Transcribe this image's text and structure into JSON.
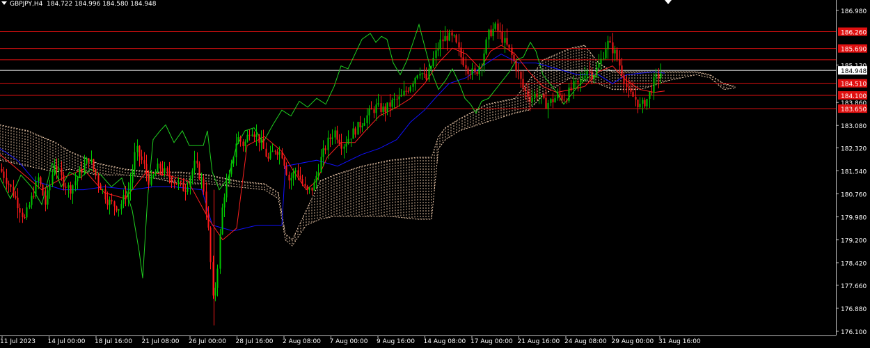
{
  "header": {
    "symbol_timeframe": "GBPJPY,H4",
    "ohlc": "184.722 184.996 184.580 184.948"
  },
  "colors": {
    "background": "#000000",
    "bull_candle": "#00c800",
    "bear_candle": "#ff1a1a",
    "tenkan": "#ff2020",
    "kijun": "#1010ff",
    "chikou": "#20d020",
    "kumo": "#f5d0b0",
    "level_line": "#e01010",
    "current_price_line": "#ffffff",
    "axis_text": "#ffffff",
    "axis_line": "#c0c0c0"
  },
  "chart_data": {
    "type": "candlestick",
    "symbol": "GBPJPY",
    "timeframe": "H4",
    "y_axis_ticks": [
      "186.980",
      "186.260",
      "185.690",
      "185.130",
      "184.948",
      "184.510",
      "184.100",
      "183.860",
      "183.650",
      "183.080",
      "182.320",
      "181.540",
      "180.760",
      "179.980",
      "179.200",
      "178.420",
      "177.660",
      "176.880",
      "176.100"
    ],
    "ylim": [
      176.1,
      187.3
    ],
    "x_axis_ticks": [
      "11 Jul 2023",
      "14 Jul 00:00",
      "18 Jul 16:00",
      "21 Jul 08:00",
      "26 Jul 00:00",
      "28 Jul 16:00",
      "2 Aug 08:00",
      "7 Aug 00:00",
      "9 Aug 16:00",
      "14 Aug 08:00",
      "17 Aug 00:00",
      "21 Aug 16:00",
      "24 Aug 08:00",
      "29 Aug 00:00",
      "31 Aug 16:00"
    ],
    "levels": [
      {
        "label": "186.260",
        "value": 186.26
      },
      {
        "label": "185.690",
        "value": 185.69
      },
      {
        "label": "185.307",
        "value": 185.307
      },
      {
        "label": "184.510",
        "value": 184.51
      },
      {
        "label": "184.100",
        "value": 184.1
      },
      {
        "label": "183.650",
        "value": 183.65
      }
    ],
    "current_price": {
      "label": "184.948",
      "value": 184.948
    },
    "price_path": [
      [
        0,
        181.6
      ],
      [
        10,
        181.2
      ],
      [
        22,
        180.6
      ],
      [
        35,
        179.9
      ],
      [
        45,
        180.6
      ],
      [
        55,
        181.3
      ],
      [
        65,
        180.4
      ],
      [
        78,
        181.8
      ],
      [
        90,
        181.2
      ],
      [
        100,
        180.9
      ],
      [
        115,
        181.5
      ],
      [
        128,
        182.0
      ],
      [
        140,
        181.2
      ],
      [
        155,
        180.5
      ],
      [
        170,
        180.3
      ],
      [
        185,
        180.9
      ],
      [
        195,
        182.3
      ],
      [
        205,
        181.8
      ],
      [
        215,
        181.1
      ],
      [
        228,
        181.7
      ],
      [
        240,
        181.4
      ],
      [
        255,
        181.1
      ],
      [
        265,
        180.9
      ],
      [
        280,
        181.8
      ],
      [
        292,
        181.0
      ],
      [
        300,
        179.3
      ],
      [
        306,
        177.0
      ],
      [
        312,
        178.3
      ],
      [
        320,
        180.6
      ],
      [
        330,
        181.4
      ],
      [
        340,
        182.7
      ],
      [
        350,
        182.4
      ],
      [
        360,
        183.0
      ],
      [
        372,
        182.6
      ],
      [
        385,
        181.9
      ],
      [
        395,
        182.3
      ],
      [
        405,
        182.1
      ],
      [
        415,
        181.2
      ],
      [
        425,
        181.6
      ],
      [
        440,
        180.8
      ],
      [
        450,
        181.0
      ],
      [
        460,
        181.9
      ],
      [
        470,
        182.5
      ],
      [
        480,
        182.9
      ],
      [
        492,
        182.4
      ],
      [
        505,
        182.8
      ],
      [
        520,
        183.2
      ],
      [
        530,
        183.5
      ],
      [
        540,
        183.7
      ],
      [
        552,
        183.6
      ],
      [
        565,
        183.9
      ],
      [
        575,
        184.0
      ],
      [
        590,
        184.5
      ],
      [
        602,
        185.0
      ],
      [
        612,
        184.6
      ],
      [
        622,
        185.3
      ],
      [
        632,
        185.9
      ],
      [
        642,
        186.1
      ],
      [
        652,
        186.0
      ],
      [
        662,
        185.4
      ],
      [
        672,
        185.0
      ],
      [
        682,
        184.8
      ],
      [
        692,
        185.3
      ],
      [
        702,
        186.2
      ],
      [
        712,
        186.4
      ],
      [
        722,
        186.0
      ],
      [
        732,
        185.6
      ],
      [
        742,
        185.0
      ],
      [
        752,
        184.3
      ],
      [
        762,
        184.0
      ],
      [
        772,
        184.2
      ],
      [
        782,
        183.8
      ],
      [
        792,
        183.9
      ],
      [
        802,
        184.1
      ],
      [
        812,
        184.0
      ],
      [
        822,
        184.4
      ],
      [
        832,
        184.5
      ],
      [
        842,
        185.0
      ],
      [
        852,
        184.8
      ],
      [
        862,
        185.2
      ],
      [
        872,
        185.9
      ],
      [
        882,
        185.6
      ],
      [
        892,
        185.0
      ],
      [
        902,
        184.2
      ],
      [
        912,
        184.0
      ],
      [
        920,
        183.7
      ],
      [
        930,
        184.0
      ],
      [
        940,
        184.6
      ],
      [
        950,
        184.9
      ]
    ],
    "tenkan_path": [
      [
        0,
        182.1
      ],
      [
        30,
        181.5
      ],
      [
        60,
        180.9
      ],
      [
        90,
        181.3
      ],
      [
        120,
        181.6
      ],
      [
        150,
        180.8
      ],
      [
        180,
        180.6
      ],
      [
        210,
        181.5
      ],
      [
        240,
        181.4
      ],
      [
        270,
        181.2
      ],
      [
        300,
        179.9
      ],
      [
        320,
        179.2
      ],
      [
        340,
        179.6
      ],
      [
        355,
        182.4
      ],
      [
        380,
        182.7
      ],
      [
        405,
        182.2
      ],
      [
        420,
        181.6
      ],
      [
        440,
        180.9
      ],
      [
        455,
        181.2
      ],
      [
        470,
        182.0
      ],
      [
        490,
        182.5
      ],
      [
        510,
        182.5
      ],
      [
        525,
        182.9
      ],
      [
        545,
        183.4
      ],
      [
        570,
        183.7
      ],
      [
        590,
        184.0
      ],
      [
        610,
        184.5
      ],
      [
        630,
        185.2
      ],
      [
        650,
        185.7
      ],
      [
        670,
        185.5
      ],
      [
        690,
        185.0
      ],
      [
        705,
        185.6
      ],
      [
        720,
        185.8
      ],
      [
        740,
        185.5
      ],
      [
        760,
        184.9
      ],
      [
        780,
        184.4
      ],
      [
        800,
        184.2
      ],
      [
        820,
        184.3
      ],
      [
        840,
        184.4
      ],
      [
        860,
        184.9
      ],
      [
        880,
        185.1
      ],
      [
        900,
        184.6
      ],
      [
        920,
        184.3
      ],
      [
        940,
        184.2
      ],
      [
        955,
        184.25
      ]
    ],
    "kijun_path": [
      [
        0,
        182.3
      ],
      [
        25,
        181.9
      ],
      [
        50,
        181.2
      ],
      [
        90,
        180.9
      ],
      [
        120,
        180.9
      ],
      [
        150,
        181.0
      ],
      [
        190,
        180.9
      ],
      [
        220,
        181.0
      ],
      [
        250,
        181.0
      ],
      [
        290,
        180.9
      ],
      [
        305,
        179.7
      ],
      [
        335,
        179.5
      ],
      [
        370,
        179.7
      ],
      [
        405,
        179.7
      ],
      [
        410,
        181.7
      ],
      [
        455,
        181.9
      ],
      [
        485,
        181.7
      ],
      [
        520,
        182.1
      ],
      [
        545,
        182.3
      ],
      [
        570,
        182.6
      ],
      [
        590,
        183.2
      ],
      [
        610,
        183.6
      ],
      [
        625,
        184.0
      ],
      [
        645,
        184.5
      ],
      [
        670,
        184.7
      ],
      [
        700,
        185.2
      ],
      [
        720,
        185.5
      ],
      [
        745,
        185.2
      ],
      [
        770,
        185.2
      ],
      [
        800,
        185.0
      ],
      [
        830,
        184.8
      ],
      [
        860,
        184.8
      ],
      [
        880,
        184.5
      ],
      [
        900,
        184.8
      ],
      [
        940,
        184.9
      ],
      [
        955,
        184.85
      ]
    ],
    "chikou_path": [
      [
        0,
        181.3
      ],
      [
        15,
        180.6
      ],
      [
        30,
        181.4
      ],
      [
        45,
        181.0
      ],
      [
        60,
        180.4
      ],
      [
        75,
        181.8
      ],
      [
        88,
        181.0
      ],
      [
        100,
        181.5
      ],
      [
        115,
        181.3
      ],
      [
        130,
        181.6
      ],
      [
        145,
        181.4
      ],
      [
        160,
        181.0
      ],
      [
        175,
        181.3
      ],
      [
        190,
        180.2
      ],
      [
        200,
        178.8
      ],
      [
        205,
        177.9
      ],
      [
        212,
        180.6
      ],
      [
        220,
        182.6
      ],
      [
        230,
        182.9
      ],
      [
        238,
        183.1
      ],
      [
        250,
        182.5
      ],
      [
        262,
        182.9
      ],
      [
        272,
        182.4
      ],
      [
        280,
        182.4
      ],
      [
        292,
        182.4
      ],
      [
        298,
        182.9
      ],
      [
        305,
        181.5
      ],
      [
        315,
        180.9
      ],
      [
        328,
        181.3
      ],
      [
        340,
        182.4
      ],
      [
        352,
        182.9
      ],
      [
        365,
        183.0
      ],
      [
        378,
        182.5
      ],
      [
        392,
        183.1
      ],
      [
        405,
        183.6
      ],
      [
        418,
        183.4
      ],
      [
        430,
        183.9
      ],
      [
        442,
        183.7
      ],
      [
        455,
        184.0
      ],
      [
        468,
        183.8
      ],
      [
        480,
        184.4
      ],
      [
        490,
        185.1
      ],
      [
        500,
        185.0
      ],
      [
        510,
        185.5
      ],
      [
        520,
        186.0
      ],
      [
        532,
        186.2
      ],
      [
        540,
        185.9
      ],
      [
        548,
        186.1
      ],
      [
        556,
        186.0
      ],
      [
        565,
        185.2
      ],
      [
        575,
        184.8
      ],
      [
        585,
        185.3
      ],
      [
        595,
        186.0
      ],
      [
        602,
        186.5
      ],
      [
        612,
        185.6
      ],
      [
        620,
        184.9
      ],
      [
        630,
        184.3
      ],
      [
        640,
        184.6
      ],
      [
        650,
        185.0
      ],
      [
        660,
        184.5
      ],
      [
        668,
        184.0
      ],
      [
        676,
        183.8
      ],
      [
        684,
        183.5
      ],
      [
        692,
        183.9
      ],
      [
        702,
        184.0
      ],
      [
        712,
        184.3
      ],
      [
        722,
        184.6
      ],
      [
        732,
        184.9
      ],
      [
        742,
        185.3
      ],
      [
        752,
        185.4
      ],
      [
        762,
        185.9
      ],
      [
        770,
        185.6
      ],
      [
        780,
        184.8
      ],
      [
        790,
        184.5
      ],
      [
        800,
        184.2
      ],
      [
        810,
        183.8
      ],
      [
        820,
        184.1
      ],
      [
        830,
        184.4
      ],
      [
        840,
        184.6
      ],
      [
        850,
        184.8
      ],
      [
        860,
        184.7
      ]
    ],
    "cloud_upper": [
      [
        0,
        183.1
      ],
      [
        40,
        182.9
      ],
      [
        80,
        182.5
      ],
      [
        100,
        182.2
      ],
      [
        140,
        181.8
      ],
      [
        180,
        181.6
      ],
      [
        220,
        181.5
      ],
      [
        260,
        181.5
      ],
      [
        300,
        181.4
      ],
      [
        340,
        181.2
      ],
      [
        380,
        181.1
      ],
      [
        400,
        180.8
      ],
      [
        410,
        179.4
      ],
      [
        420,
        179.2
      ],
      [
        440,
        180.2
      ],
      [
        460,
        181.2
      ],
      [
        480,
        181.4
      ],
      [
        520,
        181.7
      ],
      [
        560,
        181.9
      ],
      [
        600,
        182.0
      ],
      [
        620,
        182.0
      ],
      [
        630,
        182.7
      ],
      [
        640,
        183.0
      ],
      [
        660,
        183.3
      ],
      [
        700,
        183.8
      ],
      [
        740,
        184.0
      ],
      [
        760,
        184.6
      ],
      [
        780,
        185.3
      ],
      [
        800,
        185.5
      ],
      [
        820,
        185.7
      ],
      [
        840,
        185.8
      ],
      [
        860,
        185.2
      ],
      [
        880,
        184.9
      ],
      [
        920,
        184.9
      ],
      [
        960,
        184.9
      ],
      [
        1000,
        184.9
      ],
      [
        1020,
        184.8
      ],
      [
        1040,
        184.5
      ],
      [
        1056,
        184.4
      ]
    ],
    "cloud_lower": [
      [
        0,
        181.9
      ],
      [
        40,
        181.7
      ],
      [
        80,
        181.5
      ],
      [
        100,
        181.6
      ],
      [
        140,
        181.4
      ],
      [
        180,
        181.4
      ],
      [
        220,
        181.3
      ],
      [
        260,
        181.1
      ],
      [
        300,
        181.1
      ],
      [
        340,
        181.0
      ],
      [
        380,
        180.9
      ],
      [
        400,
        180.6
      ],
      [
        410,
        179.2
      ],
      [
        420,
        179.0
      ],
      [
        440,
        179.7
      ],
      [
        460,
        179.9
      ],
      [
        480,
        180.0
      ],
      [
        520,
        180.0
      ],
      [
        560,
        180.0
      ],
      [
        600,
        179.9
      ],
      [
        620,
        179.9
      ],
      [
        630,
        182.3
      ],
      [
        640,
        182.6
      ],
      [
        660,
        182.9
      ],
      [
        700,
        183.2
      ],
      [
        740,
        183.5
      ],
      [
        760,
        183.6
      ],
      [
        780,
        184.1
      ],
      [
        800,
        184.4
      ],
      [
        820,
        184.7
      ],
      [
        840,
        184.6
      ],
      [
        860,
        184.5
      ],
      [
        880,
        184.3
      ],
      [
        920,
        184.3
      ],
      [
        960,
        184.6
      ],
      [
        1000,
        184.8
      ],
      [
        1020,
        184.7
      ],
      [
        1040,
        184.3
      ],
      [
        1056,
        184.35
      ]
    ]
  }
}
